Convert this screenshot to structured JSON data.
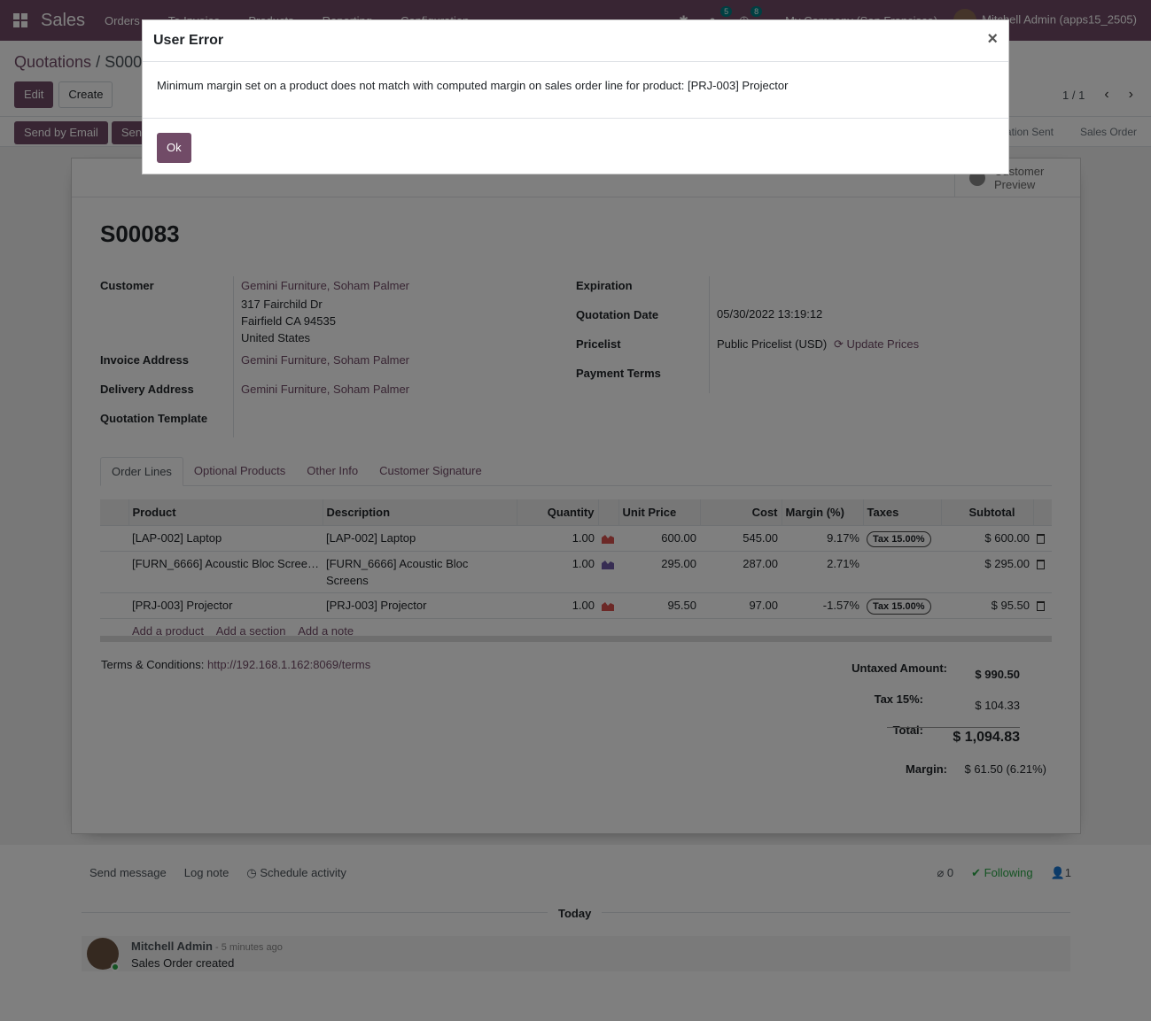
{
  "navbar": {
    "brand": "Sales",
    "menu": [
      "Orders",
      "To Invoice",
      "Products",
      "Reporting",
      "Configuration"
    ],
    "chat_badge": "5",
    "activity_badge": "8",
    "company": "My Company (San Francisco)",
    "user": "Mitchell Admin (apps15_2505)"
  },
  "control_panel": {
    "breadcrumb_parent": "Quotations",
    "breadcrumb_sep": " / ",
    "breadcrumb_current": "S00083",
    "edit_label": "Edit",
    "create_label": "Create",
    "pager": "1 / 1"
  },
  "statusbar": {
    "send_email_label": "Send by Email",
    "send_label": "Send",
    "stages": [
      "Quotation Sent",
      "Sales Order"
    ]
  },
  "sheet": {
    "preview_label_1": "Customer",
    "preview_label_2": "Preview",
    "title": "S00083"
  },
  "fields": {
    "customer_label": "Customer",
    "customer_name": "Gemini Furniture, Soham Palmer",
    "address_line1": "317 Fairchild Dr",
    "address_line2": "Fairfield CA 94535",
    "address_line3": "United States",
    "invoice_label": "Invoice Address",
    "invoice_value": "Gemini Furniture, Soham Palmer",
    "delivery_label": "Delivery Address",
    "delivery_value": "Gemini Furniture, Soham Palmer",
    "template_label": "Quotation Template",
    "expiration_label": "Expiration",
    "qdate_label": "Quotation Date",
    "qdate_value": "05/30/2022 13:19:12",
    "pricelist_label": "Pricelist",
    "pricelist_value": "Public Pricelist (USD)",
    "update_prices": "Update Prices",
    "terms_label": "Payment Terms"
  },
  "tabs": [
    "Order Lines",
    "Optional Products",
    "Other Info",
    "Customer Signature"
  ],
  "table": {
    "headers": [
      "Product",
      "Description",
      "Quantity",
      "Unit Price",
      "Cost",
      "Margin (%)",
      "Taxes",
      "Subtotal"
    ],
    "rows": [
      {
        "product": "[LAP-002] Laptop",
        "description": "[LAP-002] Laptop",
        "qty": "1.00",
        "chart_color": "#d9534f",
        "price": "600.00",
        "cost": "545.00",
        "margin": "9.17%",
        "tax": "Tax 15.00%",
        "subtotal": "$ 600.00"
      },
      {
        "product": "[FURN_6666] Acoustic Bloc Scree…",
        "description": "[FURN_6666] Acoustic Bloc Screens",
        "qty": "1.00",
        "chart_color": "#6f5ba7",
        "price": "295.00",
        "cost": "287.00",
        "margin": "2.71%",
        "tax": "",
        "subtotal": "$ 295.00"
      },
      {
        "product": "[PRJ-003] Projector",
        "description": "[PRJ-003] Projector",
        "qty": "1.00",
        "chart_color": "#d9534f",
        "price": "95.50",
        "cost": "97.00",
        "margin": "-1.57%",
        "tax": "Tax 15.00%",
        "subtotal": "$ 95.50"
      }
    ],
    "add_product": "Add a product",
    "add_section": "Add a section",
    "add_note": "Add a note"
  },
  "totals": {
    "terms_prefix": "Terms & Conditions: ",
    "terms_link": "http://192.168.1.162:8069/terms",
    "untaxed_label": "Untaxed Amount:",
    "untaxed_value": "$ 990.50",
    "tax_label": "Tax 15%:",
    "tax_value": "$ 104.33",
    "total_label": "Total:",
    "total_value": "$ 1,094.83",
    "margin_label": "Margin:",
    "margin_value": "$ 61.50 (6.21%)"
  },
  "chatter": {
    "send_message": "Send message",
    "log_note": "Log note",
    "schedule_activity": "Schedule activity",
    "attachments": "0",
    "following": "Following",
    "followers": "1",
    "today": "Today",
    "author": "Mitchell Admin",
    "time": " - 5 minutes ago",
    "body": "Sales Order created"
  },
  "dialog": {
    "title": "User Error",
    "close": "×",
    "message": "Minimum margin set on a product does not match with computed margin on sales order line for product: [PRJ-003] Projector",
    "ok_label": "Ok"
  },
  "colors": {
    "primary": "#714B67",
    "success": "#28a745"
  }
}
